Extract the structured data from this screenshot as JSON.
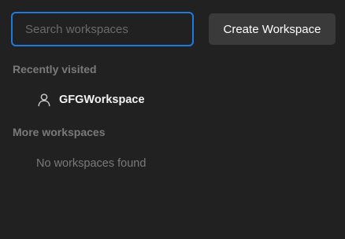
{
  "search": {
    "placeholder": "Search workspaces",
    "value": ""
  },
  "create_button": {
    "label": "Create Workspace"
  },
  "recent": {
    "heading": "Recently visited",
    "items": [
      {
        "label": "GFGWorkspace",
        "icon": "user-icon"
      }
    ]
  },
  "more": {
    "heading": "More workspaces",
    "empty_text": "No workspaces found"
  },
  "colors": {
    "background": "#212121",
    "focus_border": "#1f7ae0",
    "button_background": "#3a3a3a",
    "heading_text": "#7a7a7a",
    "primary_text": "#f2f2f2"
  }
}
